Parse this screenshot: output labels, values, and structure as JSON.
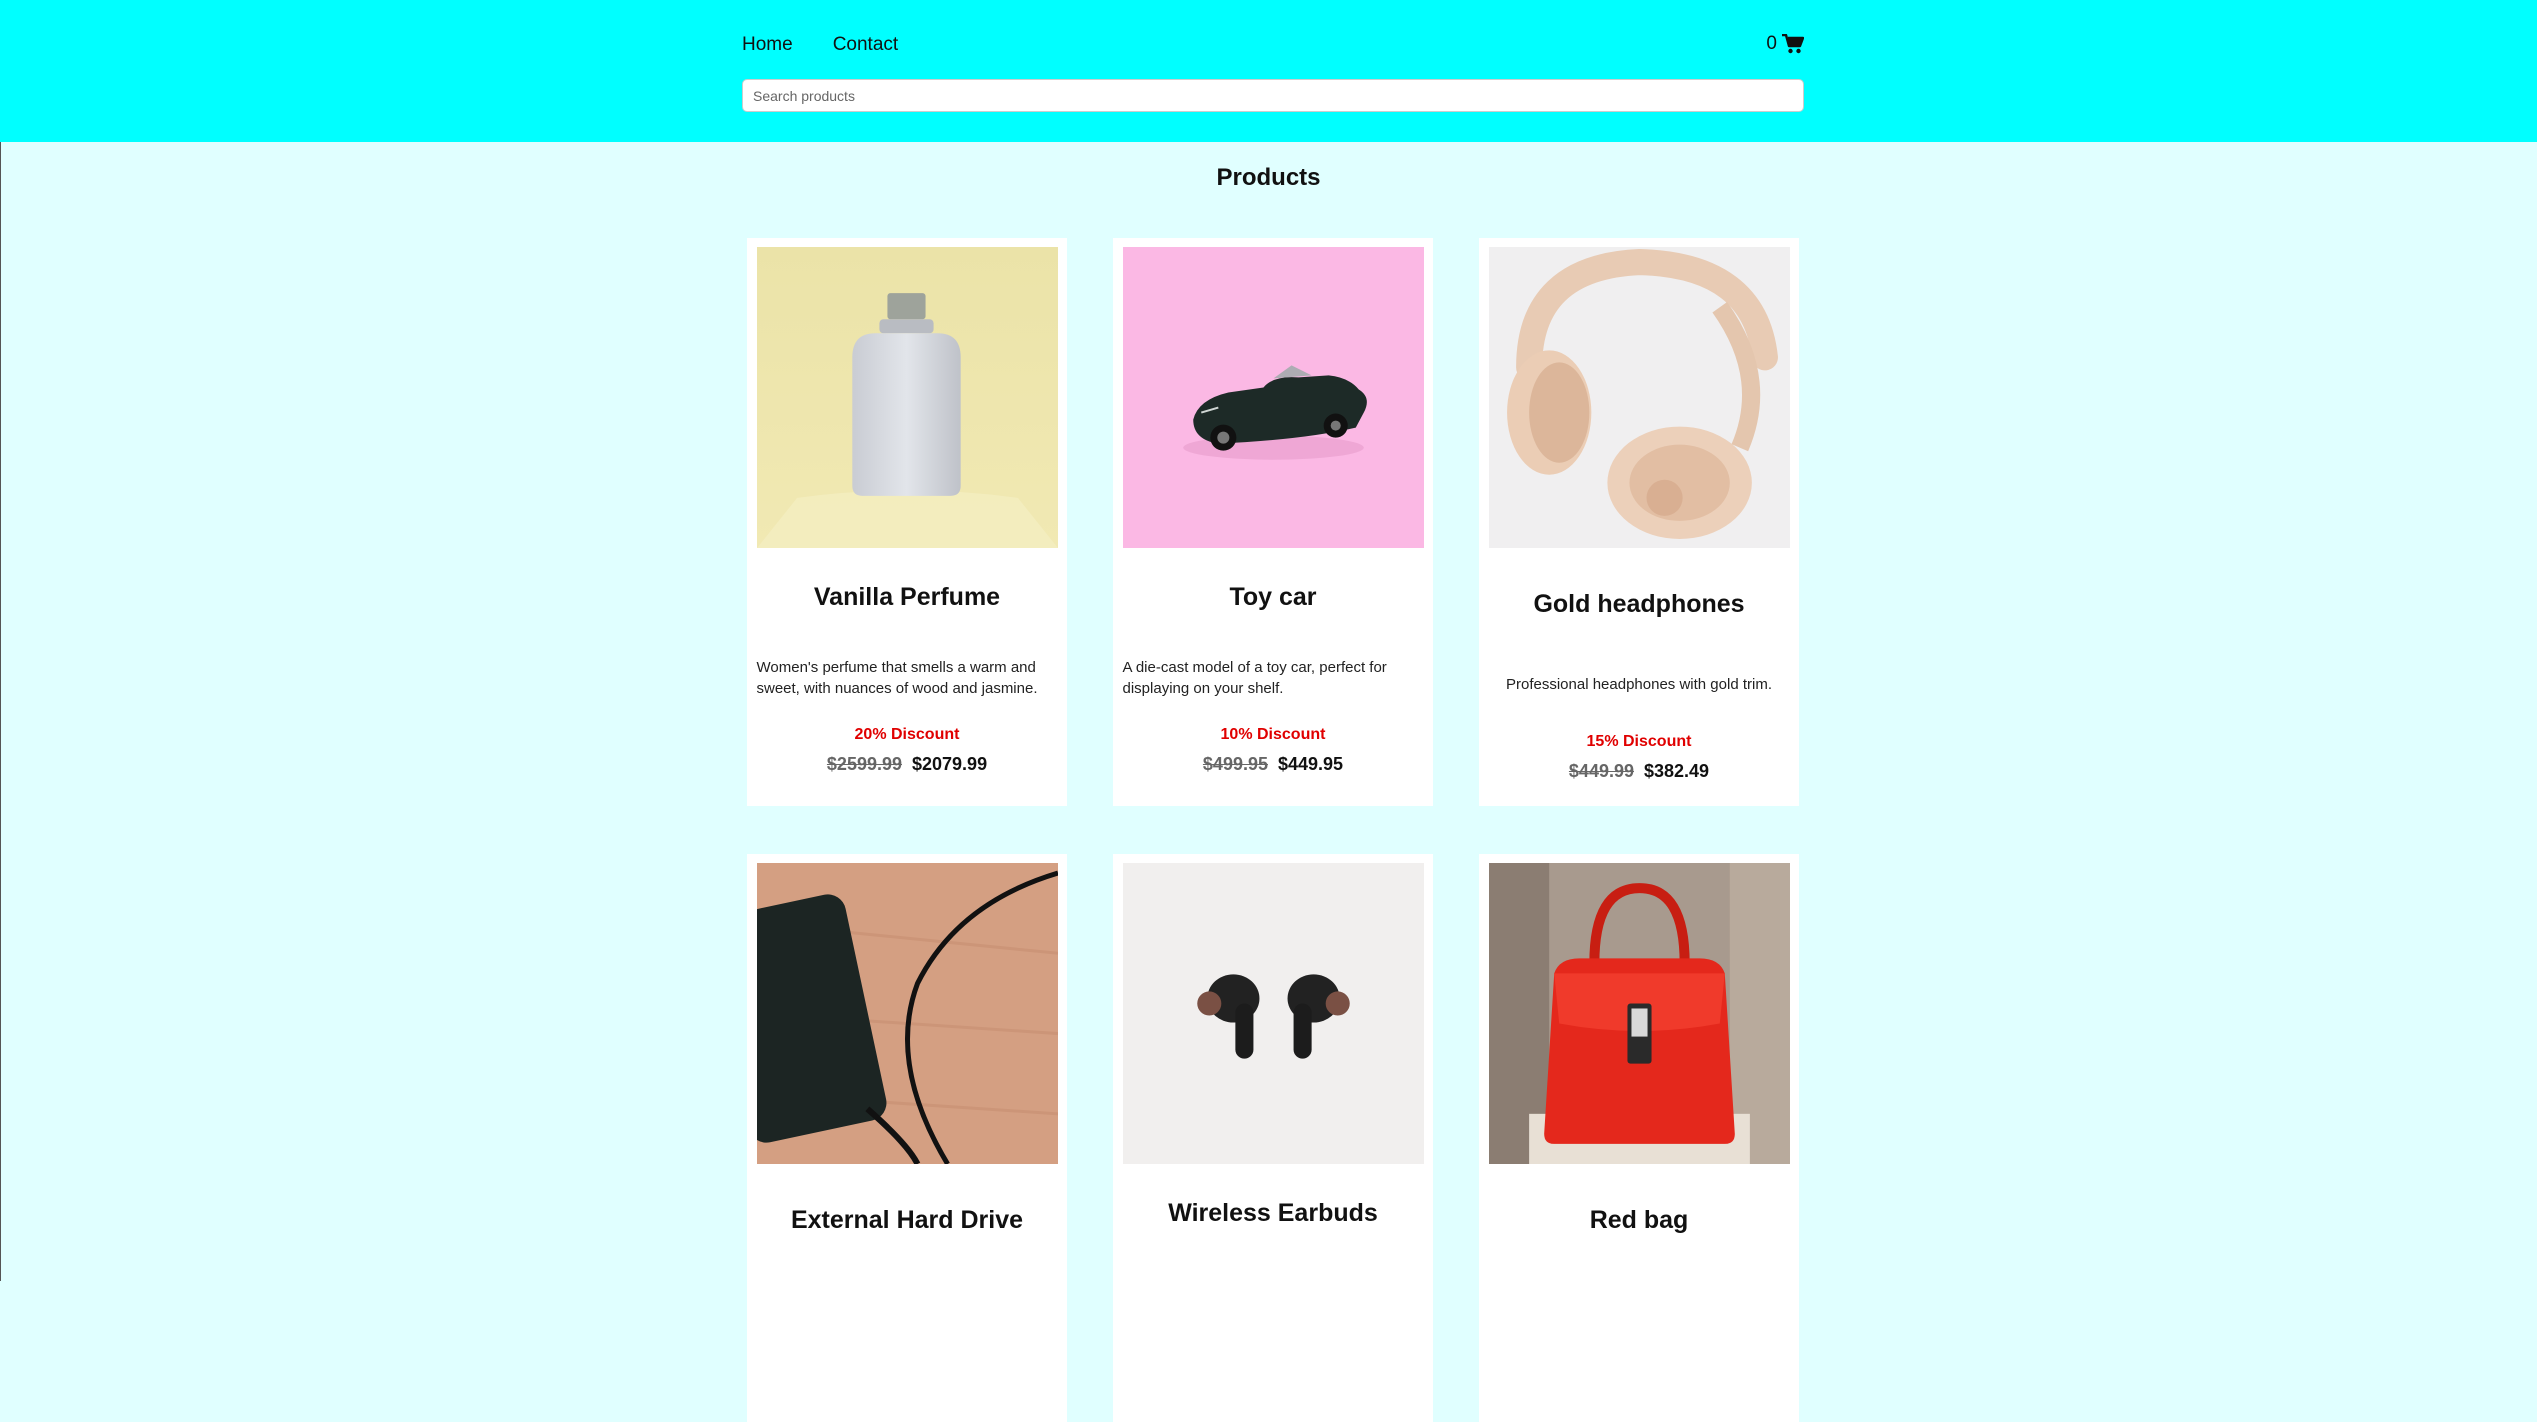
{
  "nav": {
    "home": "Home",
    "contact": "Contact"
  },
  "cart": {
    "count": "0",
    "icon": "cart-icon"
  },
  "search": {
    "placeholder": "Search products",
    "value": ""
  },
  "page_title": "Products",
  "colors": {
    "header": "#00ffff",
    "background": "#e0ffff",
    "discount": "#e00000"
  },
  "products": [
    {
      "title": "Vanilla Perfume",
      "description": "Women's perfume that smells a warm and sweet, with nuances of wood and jasmine.",
      "discount": "20% Discount",
      "old_price": "$2599.99",
      "new_price": "$2079.99",
      "image": "perfume-bottle"
    },
    {
      "title": "Toy car",
      "description": "A die-cast model of a toy car, perfect for displaying on your shelf.",
      "discount": "10% Discount",
      "old_price": "$499.95",
      "new_price": "$449.95",
      "image": "toy-car"
    },
    {
      "title": "Gold headphones",
      "description": "Professional headphones with gold trim.",
      "discount": "15% Discount",
      "old_price": "$449.99",
      "new_price": "$382.49",
      "image": "headphones"
    },
    {
      "title": "External Hard Drive",
      "image": "hard-drive"
    },
    {
      "title": "Wireless Earbuds",
      "image": "earbuds"
    },
    {
      "title": "Red bag",
      "image": "red-handbag"
    }
  ]
}
